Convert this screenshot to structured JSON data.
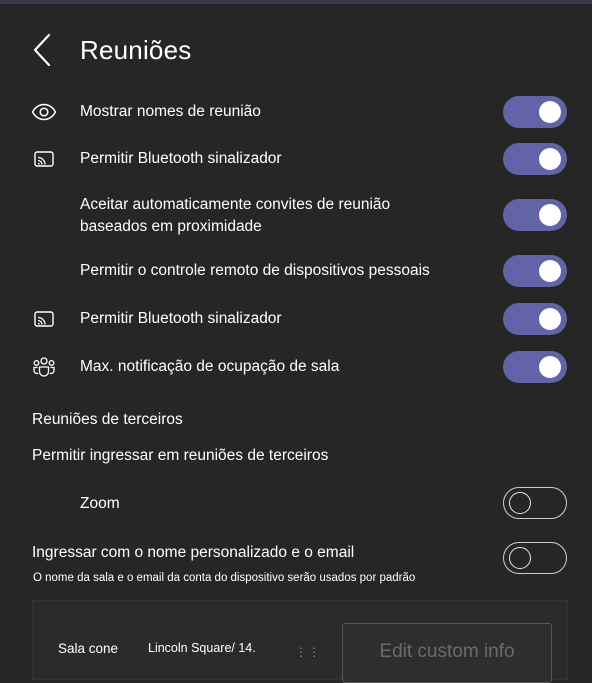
{
  "header": {
    "back_icon": "chevron-left-icon",
    "title": "Reuniões"
  },
  "settings": [
    {
      "icon": "eye-icon",
      "label": "Mostrar nomes de reunião",
      "enabled": true
    },
    {
      "icon": "cast-icon",
      "label": "Permitir Bluetooth sinalizador",
      "enabled": true
    },
    {
      "icon": "",
      "label_line1": "Aceitar automaticamente convites de reunião",
      "label_line2": "baseados em proximidade",
      "enabled": true
    },
    {
      "icon": "",
      "label": "Permitir o controle remoto de dispositivos pessoais",
      "enabled": true
    },
    {
      "icon": "cast-icon",
      "label": "Permitir Bluetooth sinalizador",
      "enabled": true
    },
    {
      "icon": "people-group-icon",
      "label": "Max. notificação de ocupação de sala",
      "enabled": true
    }
  ],
  "third_party": {
    "heading": "Reuniões de terceiros",
    "subheading": "Permitir ingressar em reuniões de terceiros",
    "zoom_label": "Zoom",
    "zoom_enabled": false
  },
  "custom_join": {
    "label": "Ingressar com o nome personalizado e o email",
    "note": "O nome da sala e o email da conta do dispositivo serão usados por padrão",
    "enabled": false
  },
  "room_panel": {
    "room_label": "Sala cone",
    "room_value": "Lincoln Square/ 14.",
    "dots": "⋮⋮",
    "edit_button": "Edit custom info"
  },
  "colors": {
    "accent": "#6264a7",
    "background": "#262626"
  }
}
